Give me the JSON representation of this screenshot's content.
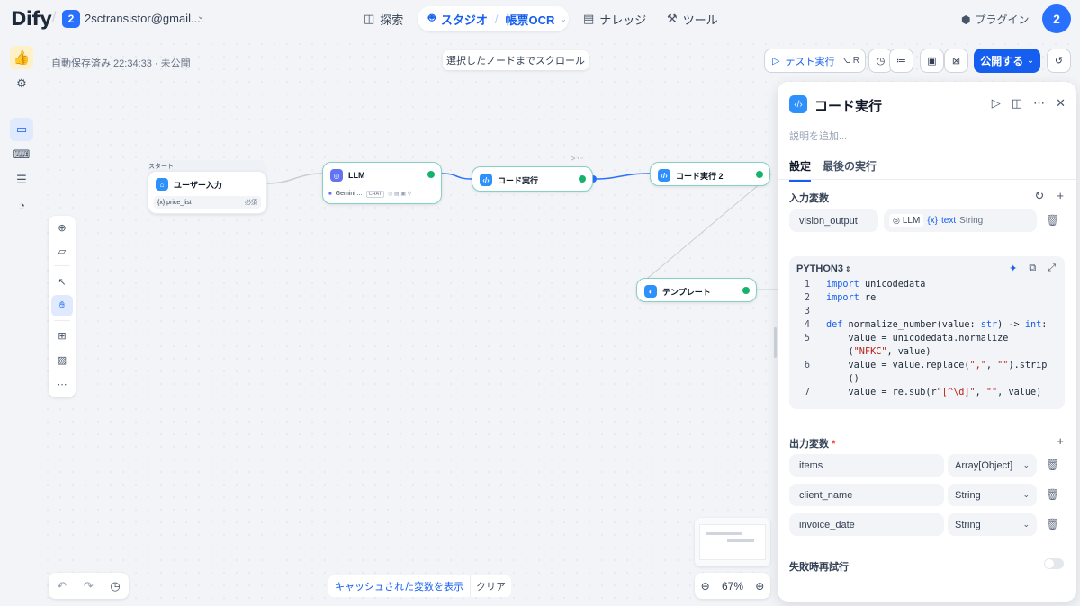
{
  "header": {
    "logo": "Dify",
    "workspace_badge": "2",
    "workspace_name": "2sctransistor@gmail....",
    "nav": {
      "explore": "探索",
      "studio": "スタジオ",
      "app_name": "帳票OCR",
      "knowledge": "ナレッジ",
      "tools": "ツール"
    },
    "plugins": "プラグイン",
    "avatar": "2"
  },
  "toolbar": {
    "autosave": "自動保存済み 22:34:33 · 未公開",
    "scroll_to_node": "選択したノードまでスクロール",
    "test_run": "テスト実行",
    "test_run_kbd": "⌥ R",
    "publish": "公開する"
  },
  "nodes": {
    "start_label": "スタート",
    "start": {
      "title": "ユーザー入力",
      "var": "{x} price_list",
      "req": "必須"
    },
    "llm": {
      "title": "LLM",
      "model": "Gemini ...",
      "mode": "CHAT"
    },
    "code1": {
      "title": "コード実行"
    },
    "code2": {
      "title": "コード実行 2"
    },
    "template": {
      "title": "テンプレート"
    }
  },
  "bottom": {
    "cache_show": "キャッシュされた変数を表示",
    "clear": "クリア",
    "zoom": "67%"
  },
  "panel": {
    "title": "コード実行",
    "description_placeholder": "説明を追加...",
    "tabs": [
      "設定",
      "最後の実行"
    ],
    "input_vars_label": "入力変数",
    "input_var_name": "vision_output",
    "input_ref_node": "LLM",
    "input_ref_var": "text",
    "input_ref_type": "String",
    "language": "PYTHON3",
    "code_lines": [
      {
        "n": "1",
        "html": "<span class=\"kw\">import</span> unicodedata"
      },
      {
        "n": "2",
        "html": "<span class=\"kw\">import</span> re"
      },
      {
        "n": "3",
        "html": ""
      },
      {
        "n": "4",
        "html": "<span class=\"kw\">def</span> normalize_number(value: <span class=\"kw\">str</span>) -> <span class=\"kw\">int</span>:"
      },
      {
        "n": "5",
        "html": "    value = unicodedata.normalize"
      },
      {
        "n": "",
        "html": "    (<span class=\"str\">\"NFKC\"</span>, value)"
      },
      {
        "n": "6",
        "html": "    value = value.replace(<span class=\"str\">\",\"</span>, <span class=\"str\">\"\"</span>).strip"
      },
      {
        "n": "",
        "html": "    ()"
      },
      {
        "n": "7",
        "html": "    value = re.sub(r<span class=\"str\">\"[^\\d]\"</span>, <span class=\"str\">\"\"</span>, value)"
      }
    ],
    "output_vars_label": "出力変数",
    "required_mark": "*",
    "outputs": [
      {
        "name": "items",
        "type": "Array[Object]"
      },
      {
        "name": "client_name",
        "type": "String"
      },
      {
        "name": "invoice_date",
        "type": "String"
      }
    ],
    "retry_label": "失敗時再試行",
    "retry_enabled": false
  },
  "colors": {
    "accent": "#155eef",
    "success": "#17b26a",
    "node_icon": "#2e90fa"
  }
}
